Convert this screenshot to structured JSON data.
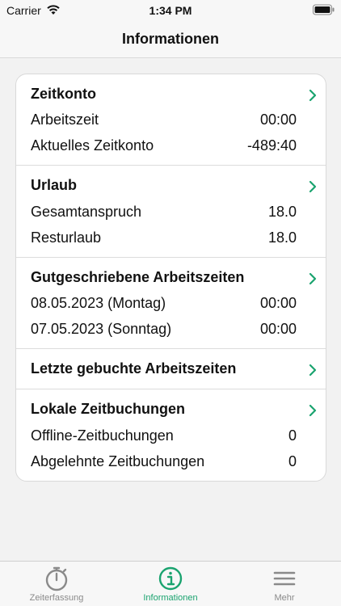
{
  "status_bar": {
    "carrier": "Carrier",
    "time": "1:34 PM"
  },
  "nav": {
    "title": "Informationen"
  },
  "colors": {
    "accent": "#1aa36f",
    "inactive": "#8a8a8a"
  },
  "sections": {
    "zeitkonto": {
      "title": "Zeitkonto",
      "rows": [
        {
          "label": "Arbeitszeit",
          "value": "00:00"
        },
        {
          "label": "Aktuelles Zeitkonto",
          "value": "-489:40"
        }
      ]
    },
    "urlaub": {
      "title": "Urlaub",
      "rows": [
        {
          "label": "Gesamtanspruch",
          "value": "18.0"
        },
        {
          "label": "Resturlaub",
          "value": "18.0"
        }
      ]
    },
    "gutgeschrieben": {
      "title": "Gutgeschriebene Arbeitszeiten",
      "rows": [
        {
          "label": "08.05.2023 (Montag)",
          "value": "00:00"
        },
        {
          "label": "07.05.2023 (Sonntag)",
          "value": "00:00"
        }
      ]
    },
    "letzte": {
      "title": "Letzte gebuchte Arbeitszeiten"
    },
    "lokale": {
      "title": "Lokale Zeitbuchungen",
      "rows": [
        {
          "label": "Offline-Zeitbuchungen",
          "value": "0"
        },
        {
          "label": "Abgelehnte Zeitbuchungen",
          "value": "0"
        }
      ]
    }
  },
  "tabs": [
    {
      "label": "Zeiterfassung",
      "icon": "stopwatch-icon",
      "active": false
    },
    {
      "label": "Informationen",
      "icon": "info-icon",
      "active": true
    },
    {
      "label": "Mehr",
      "icon": "menu-icon",
      "active": false
    }
  ]
}
